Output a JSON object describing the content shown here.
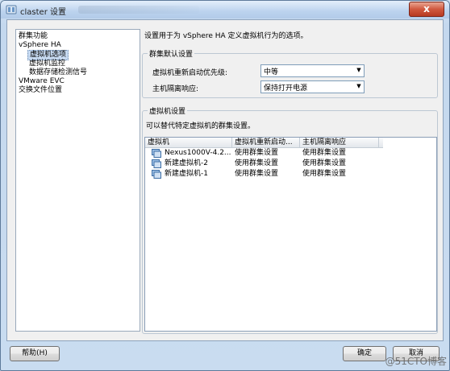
{
  "window": {
    "title": "claster 设置",
    "close_glyph": "x",
    "accent_title_bar": "#bcd3ee",
    "close_color": "#c8452c"
  },
  "nav": {
    "items": [
      {
        "label": "群集功能",
        "level": 0,
        "selected": false
      },
      {
        "label": "vSphere HA",
        "level": 0,
        "selected": false
      },
      {
        "label": "虚拟机选项",
        "level": 1,
        "selected": true
      },
      {
        "label": "虚拟机监控",
        "level": 1,
        "selected": false
      },
      {
        "label": "数据存储检测信号",
        "level": 1,
        "selected": false
      },
      {
        "label": "VMware EVC",
        "level": 0,
        "selected": false
      },
      {
        "label": "交换文件位置",
        "level": 0,
        "selected": false
      }
    ]
  },
  "main": {
    "description": "设置用于为 vSphere HA 定义虚拟机行为的选项。",
    "cluster_defaults": {
      "title": "群集默认设置",
      "restart_priority_label": "虚拟机重新启动优先级:",
      "restart_priority_value": "中等",
      "isolation_response_label": "主机隔离响应:",
      "isolation_response_value": "保持打开电源"
    },
    "vm_settings": {
      "title": "虚拟机设置",
      "description": "可以替代特定虚拟机的群集设置。",
      "columns": [
        "虚拟机",
        "虚拟机重新启动...",
        "主机隔离响应"
      ],
      "rows": [
        {
          "vm": "Nexus1000V-4.2...",
          "restart": "使用群集设置",
          "isolation": "使用群集设置"
        },
        {
          "vm": "新建虚拟机-2",
          "restart": "使用群集设置",
          "isolation": "使用群集设置"
        },
        {
          "vm": "新建虚拟机-1",
          "restart": "使用群集设置",
          "isolation": "使用群集设置"
        }
      ]
    }
  },
  "footer": {
    "help_label": "帮助(H)",
    "ok_label": "确定",
    "cancel_label": "取消"
  },
  "watermark": "@51CTO博客"
}
